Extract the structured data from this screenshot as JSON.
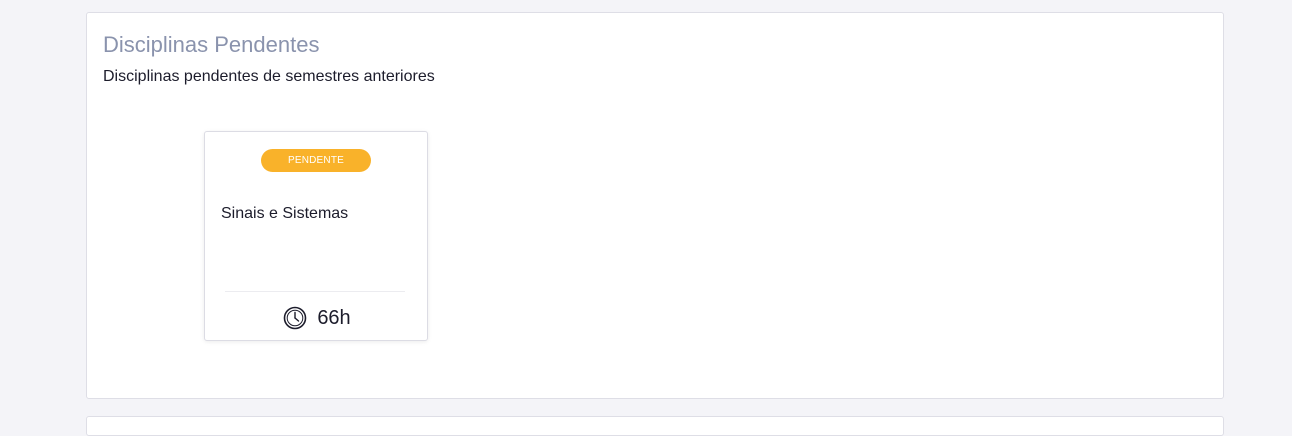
{
  "section": {
    "title": "Disciplinas Pendentes",
    "subtitle": "Disciplinas pendentes de semestres anteriores"
  },
  "courses": [
    {
      "status": "PENDENTE",
      "status_color": "#f9b22a",
      "name": "Sinais e Sistemas",
      "hours": "66h",
      "hours_icon": "clock-icon"
    }
  ],
  "colors": {
    "title": "#8a93ad",
    "text": "#1c1c2b",
    "page_bg": "#f4f4f8",
    "card_border": "#dcdce4"
  }
}
